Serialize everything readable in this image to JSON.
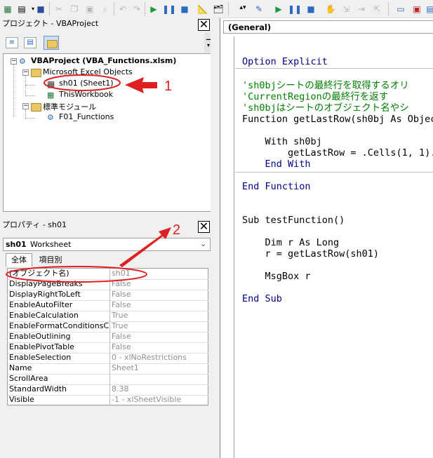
{
  "project_panel": {
    "title": "プロジェクト - VBAProject",
    "tree": {
      "root": "VBAProject (VBA_Functions.xlsm)",
      "excel_objects_folder": "Microsoft Excel Objects",
      "sheet_item": "sh01 (Sheet1)",
      "workbook_item": "ThisWorkbook",
      "modules_folder": "標準モジュール",
      "module_item": "F01_Functions"
    }
  },
  "properties_panel": {
    "title": "プロパティ - sh01",
    "object_selector": {
      "name": "sh01",
      "type": "Worksheet"
    },
    "tabs": [
      "全体",
      "項目別"
    ],
    "rows": [
      {
        "name": "(オブジェクト名)",
        "value": "sh01"
      },
      {
        "name": "DisplayPageBreaks",
        "value": "False"
      },
      {
        "name": "DisplayRightToLeft",
        "value": "False"
      },
      {
        "name": "EnableAutoFilter",
        "value": "False"
      },
      {
        "name": "EnableCalculation",
        "value": "True"
      },
      {
        "name": "EnableFormatConditionsCalcu",
        "value": "True"
      },
      {
        "name": "EnableOutlining",
        "value": "False"
      },
      {
        "name": "EnablePivotTable",
        "value": "False"
      },
      {
        "name": "EnableSelection",
        "value": "0 - xlNoRestrictions"
      },
      {
        "name": "Name",
        "value": "Sheet1"
      },
      {
        "name": "ScrollArea",
        "value": ""
      },
      {
        "name": "StandardWidth",
        "value": "8.38"
      },
      {
        "name": "Visible",
        "value": "-1 - xlSheetVisible"
      }
    ]
  },
  "code_window": {
    "object_dropdown": "(General)",
    "lines": [
      {
        "kind": "kw",
        "text": "Option Explicit"
      },
      {
        "kind": "cm",
        "text": "'sh0bjシートの最終行を取得するオリ"
      },
      {
        "kind": "cm",
        "text": "'CurrentRegionの最終行を返す"
      },
      {
        "kind": "cm",
        "text": "'sh0bjはシートのオブジェクト名やシ"
      },
      {
        "kind": "tx",
        "text": "Function getLastRow(sh0bj As Objec"
      },
      {
        "kind": "tx",
        "text": "    With sh0bj"
      },
      {
        "kind": "tx",
        "text": "        getLastRow = .Cells(1, 1)."
      },
      {
        "kind": "kw",
        "text": "    End With"
      },
      {
        "kind": "kw",
        "text": "End Function"
      },
      {
        "kind": "tx",
        "text": "Sub testFunction()"
      },
      {
        "kind": "tx",
        "text": "    Dim r As Long"
      },
      {
        "kind": "tx",
        "text": "    r = getLastRow(sh01)"
      },
      {
        "kind": "tx",
        "text": "    MsgBox r"
      },
      {
        "kind": "kw",
        "text": "End Sub"
      }
    ]
  },
  "annotations": {
    "label_1": "1",
    "label_2": "2",
    "color": "#e02020"
  }
}
